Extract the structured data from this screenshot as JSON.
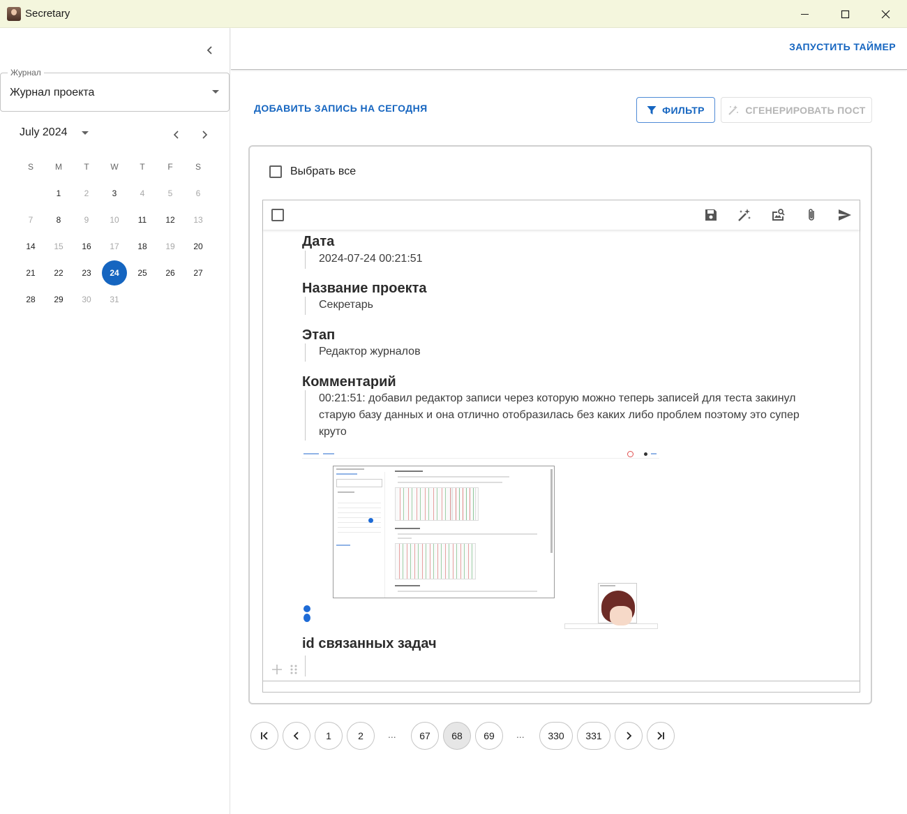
{
  "window": {
    "title": "Secretary",
    "controls": [
      "minimize-icon",
      "maximize-icon",
      "close-icon"
    ]
  },
  "sidebar": {
    "journal_label": "Журнал",
    "journal_value": "Журнал проекта",
    "calendar": {
      "month_label": "July 2024",
      "weekdays": [
        "S",
        "M",
        "T",
        "W",
        "T",
        "F",
        "S"
      ],
      "weeks": [
        [
          {
            "d": ""
          },
          {
            "d": "1"
          },
          {
            "d": "2",
            "off": true
          },
          {
            "d": "3"
          },
          {
            "d": "4",
            "off": true
          },
          {
            "d": "5",
            "off": true
          },
          {
            "d": "6",
            "off": true
          }
        ],
        [
          {
            "d": "7",
            "off": true
          },
          {
            "d": "8"
          },
          {
            "d": "9",
            "off": true
          },
          {
            "d": "10",
            "off": true
          },
          {
            "d": "11"
          },
          {
            "d": "12"
          },
          {
            "d": "13",
            "off": true
          }
        ],
        [
          {
            "d": "14"
          },
          {
            "d": "15",
            "off": true
          },
          {
            "d": "16"
          },
          {
            "d": "17",
            "off": true
          },
          {
            "d": "18"
          },
          {
            "d": "19",
            "off": true
          },
          {
            "d": "20"
          }
        ],
        [
          {
            "d": "21"
          },
          {
            "d": "22"
          },
          {
            "d": "23"
          },
          {
            "d": "24",
            "sel": true
          },
          {
            "d": "25"
          },
          {
            "d": "26"
          },
          {
            "d": "27"
          }
        ],
        [
          {
            "d": "28"
          },
          {
            "d": "29"
          },
          {
            "d": "30",
            "off": true
          },
          {
            "d": "31",
            "off": true
          },
          {
            "d": ""
          },
          {
            "d": ""
          },
          {
            "d": ""
          }
        ]
      ]
    }
  },
  "topbar": {
    "timer_label": "ЗАПУСТИТЬ ТАЙМЕР"
  },
  "actions": {
    "add_entry": "ДОБАВИТЬ ЗАПИСЬ НА СЕГОДНЯ",
    "filter": "ФИЛЬТР",
    "generate_post": "СГЕНЕРИРОВАТЬ ПОСТ"
  },
  "list": {
    "select_all": "Выбрать все",
    "entry": {
      "toolbar_icons": [
        "save-icon",
        "magic-wand-icon",
        "image-search-icon",
        "attach-icon",
        "send-icon"
      ],
      "fields": [
        {
          "heading": "Дата",
          "value": "2024-07-24 00:21:51"
        },
        {
          "heading": "Название проекта",
          "value": "Секретарь"
        },
        {
          "heading": "Этап",
          "value": "Редактор журналов"
        },
        {
          "heading": "Комментарий",
          "value": "00:21:51: добавил редактор записи через которую можно теперь записей для теста закинул старую базу данных и она отлично отобразилась без каких либо проблем поэтому это супер круто"
        },
        {
          "heading": "id связанных задач",
          "value": ""
        }
      ]
    }
  },
  "pagination": {
    "pages": [
      "1",
      "2",
      "67",
      "68",
      "69",
      "330",
      "331"
    ],
    "current": "68",
    "ellipsis": "..."
  },
  "colors": {
    "accent": "#1565c0",
    "titlebar": "#f4f6dd",
    "disabled": "#b5b5b5"
  }
}
